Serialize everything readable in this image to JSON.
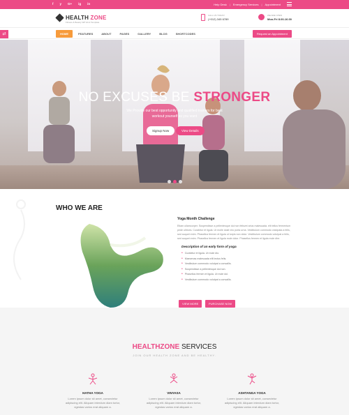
{
  "topbar": {
    "social": [
      "f",
      "y",
      "G+",
      "ig",
      "in"
    ],
    "links": [
      "Help Desk",
      "Emergency Services",
      "Appointment"
    ]
  },
  "header": {
    "logo_main": "HEALTH",
    "logo_accent": "ZONE",
    "logo_tag": "Fitness & Beauty WP Html Template",
    "call_label": "CALL US TODAY!",
    "call_value": "(+012) 345 6789",
    "open_label": "WE ARE OPEN",
    "open_value": "Mon-Fri 8.00-16.00"
  },
  "nav": {
    "items": [
      "HOME",
      "FEATURES",
      "ABOUT",
      "PAGES",
      "GALLERY",
      "BLOG",
      "SHORTCODES"
    ],
    "cta": "Request an Appointment",
    "toggle": "⇄"
  },
  "hero": {
    "title_a": "NO EXCUSES BE ",
    "title_b": "STRONGER",
    "subtitle": "We Provide our best opportunity and qualified trainers for best workout yourself as you want",
    "signup": "Signup Now",
    "details": "View Details"
  },
  "who": {
    "title": "WHO WE ARE",
    "challenge": "Yoga Month Challenge",
    "para": "Etiam ullamcorper. Suspendisse a pellentesque dui non felisvet arius malesuada. elit tellus fermentum pede ultrices. Curabitur et ligula. Ut molle dosit viro porta urna. Vestibulum commodo volutpata a felis, sed auquet enim. Phasellus fermen et ligula ut turpis non dolor. Vestibulum commodo volutpat a felis, sed auquet enim. Phasellus fermen et ligula mole dolor. Phasellus fermen et ligula mole dhe.",
    "desc_title": "Description of an early form of yoga",
    "list": [
      "Curabitur et ligula. Ut mole dio.",
      "Maecenas malesuada elit lectus felis.",
      "Vestibulum commodo volutpat a convallis.",
      "Suspendisse a pellentesque dui non.",
      "Phasellus fermen et ligula. Ut mole dol.",
      "Vestibulum commodo volutpat a convallis."
    ],
    "btn_more": "VIEW MORE",
    "btn_buy": "PURCHASE NOW"
  },
  "services": {
    "title_a": "HEALTHZONE",
    "title_b": " SERVICES",
    "tagline": "JOIN OUR HEALTH ZONE AND BE HEALTHY.",
    "items": [
      {
        "name": "HATHA YOGA",
        "text": "Lorem ipsum dolor sit amet, consectetur adipiscing elit. Aliquam interdum diam tortor, egestas varius erat aliquam a."
      },
      {
        "name": "VINYASA",
        "text": "Lorem ipsum dolor sit amet, consectetur adipiscing elit. Aliquam interdum diam tortor, egestas varius erat aliquam a."
      },
      {
        "name": "ASHTANGA YOGA",
        "text": "Lorem ipsum dolor sit amet, consectetur adipiscing elit. Aliquam interdum diam tortor, egestas varius erat aliquam a."
      }
    ]
  },
  "colors": {
    "accent": "#ec4a86",
    "orange": "#f79b3b"
  }
}
